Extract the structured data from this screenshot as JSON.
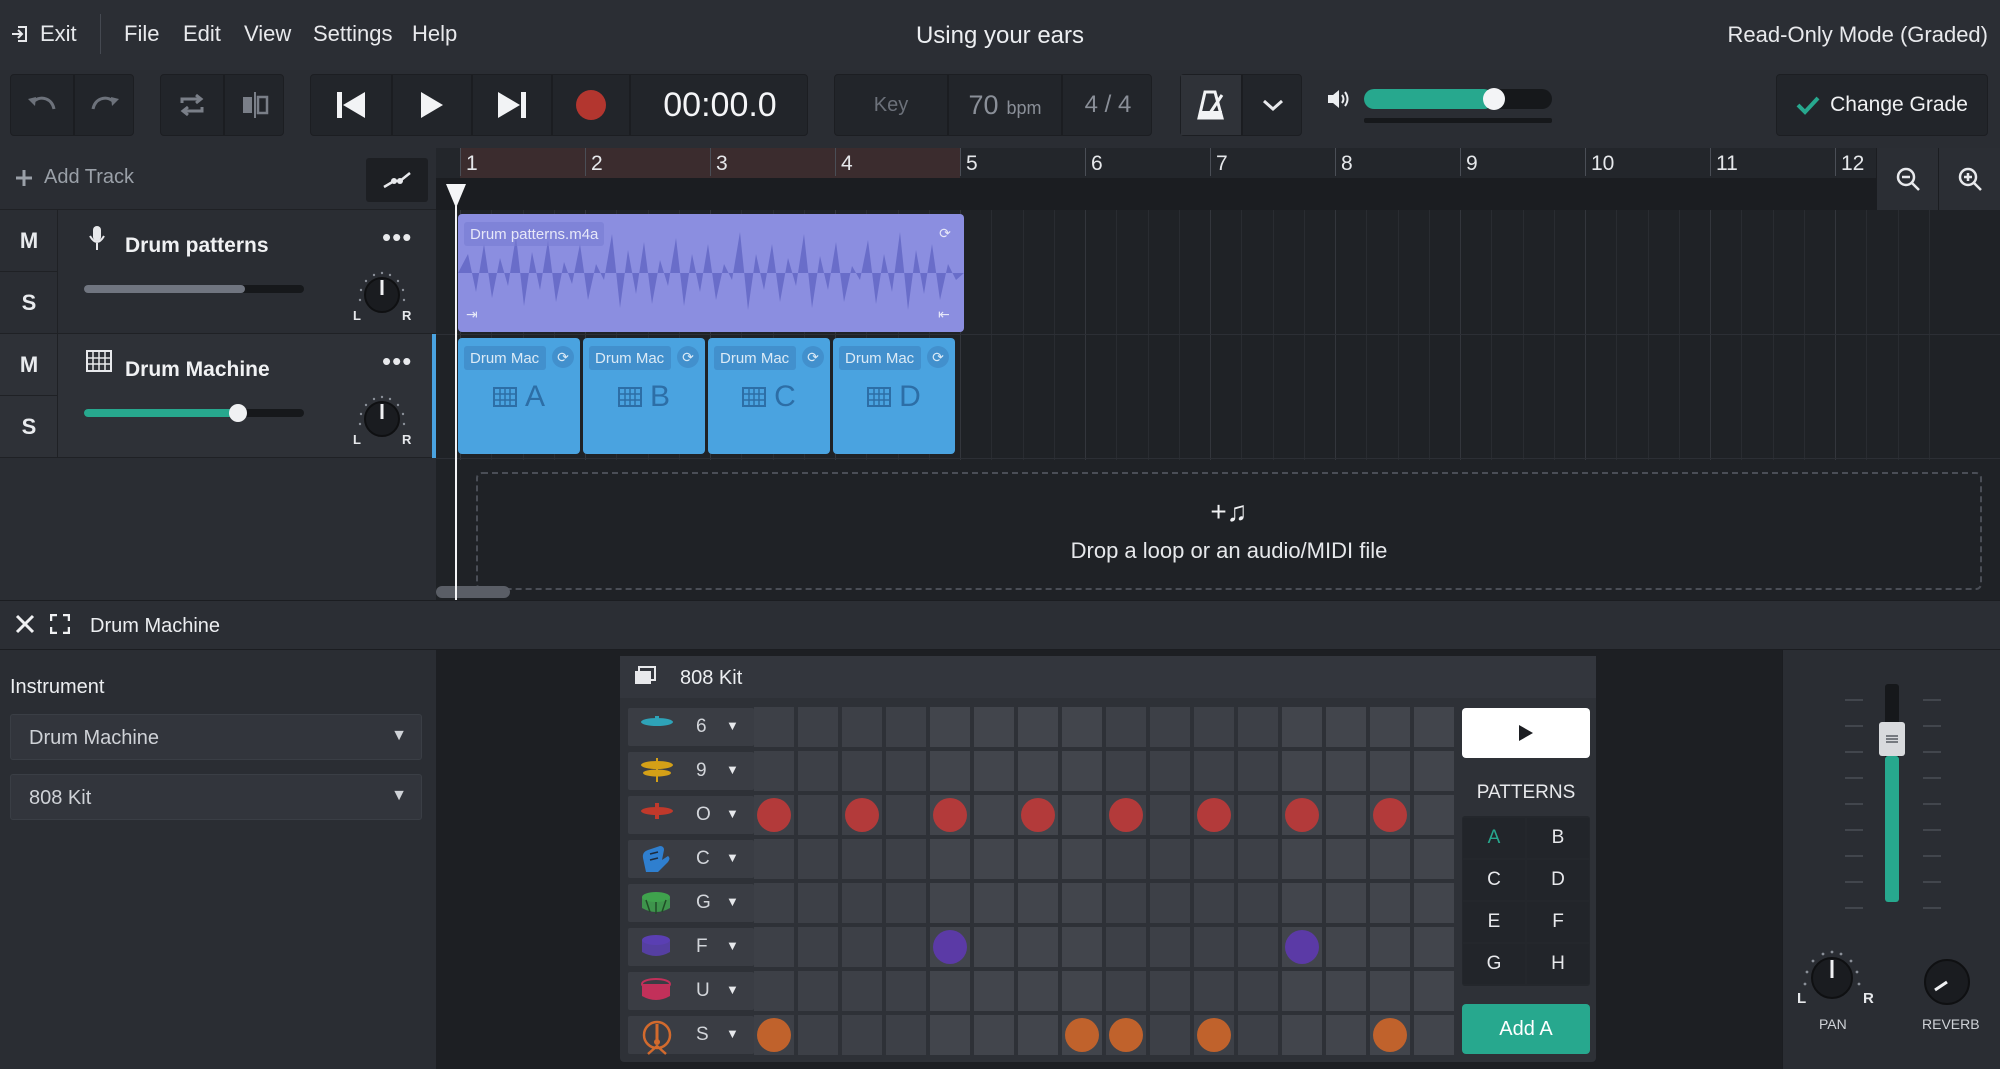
{
  "menubar": {
    "exit_label": "Exit",
    "items": [
      "File",
      "Edit",
      "View",
      "Settings",
      "Help"
    ],
    "title": "Using your ears",
    "mode": "Read-Only Mode (Graded)"
  },
  "transport": {
    "time": "00:00.0",
    "key_placeholder": "Key",
    "tempo": "70",
    "tempo_unit": "bpm",
    "time_signature": "4 / 4",
    "master_volume": 0.69,
    "change_grade_label": "Change Grade"
  },
  "tracks": {
    "add_track_label": "Add Track",
    "list": [
      {
        "mute": "M",
        "solo": "S",
        "name": "Drum patterns",
        "icon": "microphone-icon",
        "volume": 0.73,
        "pan_left": "L",
        "pan_right": "R"
      },
      {
        "mute": "M",
        "solo": "S",
        "name": "Drum Machine",
        "icon": "grid-icon",
        "volume": 0.7,
        "pan_left": "L",
        "pan_right": "R"
      }
    ]
  },
  "timeline": {
    "bars": [
      "1",
      "2",
      "3",
      "4",
      "5",
      "6",
      "7",
      "8",
      "9",
      "10",
      "11",
      "12"
    ],
    "audio_clip_label": "Drum patterns.m4a",
    "pattern_clips": [
      {
        "label": "Drum Mac",
        "pattern": "A"
      },
      {
        "label": "Drum Mac",
        "pattern": "B"
      },
      {
        "label": "Drum Mac",
        "pattern": "C"
      },
      {
        "label": "Drum Mac",
        "pattern": "D"
      }
    ],
    "drop_text": "Drop a loop or an audio/MIDI file",
    "drop_icon": "+♫"
  },
  "panel": {
    "title": "Drum Machine",
    "instrument_heading": "Instrument",
    "instrument_value": "Drum Machine",
    "kit_value": "808 Kit"
  },
  "drum_machine": {
    "kit_name": "808 Kit",
    "steps": 16,
    "rows": [
      {
        "key": "6",
        "icon": "cymbal-icon",
        "color": "#2ea3b8",
        "hits": []
      },
      {
        "key": "9",
        "icon": "crash-cymbal-icon",
        "color": "#d4a017",
        "hits": []
      },
      {
        "key": "O",
        "icon": "hihat-icon",
        "color": "#c0392b",
        "hit_color": "#b33a3a",
        "hits": [
          0,
          2,
          4,
          6,
          8,
          10,
          12,
          14
        ]
      },
      {
        "key": "C",
        "icon": "clap-icon",
        "color": "#2f7fcf",
        "hits": []
      },
      {
        "key": "G",
        "icon": "snare-icon",
        "color": "#3fa34d",
        "hits": []
      },
      {
        "key": "F",
        "icon": "tom-icon",
        "color": "#5b3fb3",
        "hit_color": "#5b3aa6",
        "hits": [
          4,
          12
        ]
      },
      {
        "key": "U",
        "icon": "drum-icon",
        "color": "#c2305a",
        "hits": []
      },
      {
        "key": "S",
        "icon": "kick-drum-icon",
        "color": "#d26a2d",
        "hit_color": "#c0622c",
        "hits": [
          0,
          7,
          8,
          10,
          14
        ]
      }
    ],
    "patterns_title": "PATTERNS",
    "patterns": [
      "A",
      "B",
      "C",
      "D",
      "E",
      "F",
      "G",
      "H"
    ],
    "active_pattern": "A",
    "add_pattern_label": "Add A"
  },
  "mixer": {
    "fader_level": 0.67,
    "pan_label": "PAN",
    "reverb_label": "REVERB",
    "pan_left": "L",
    "pan_right": "R"
  },
  "colors": {
    "accent": "#27a88e",
    "audio_clip": "#8b8ee0",
    "pattern_clip": "#4aa3e0"
  }
}
